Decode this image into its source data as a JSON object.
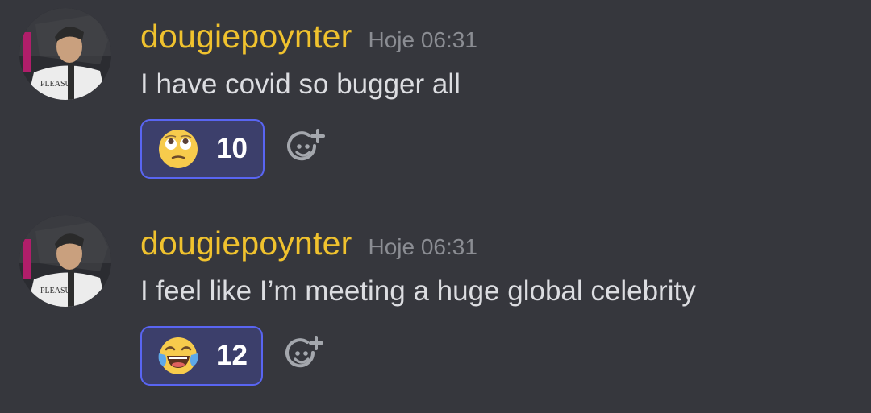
{
  "messages": [
    {
      "username": "dougiepoynter",
      "timestamp": "Hoje 06:31",
      "text": "I have covid so bugger all",
      "avatar_shirt_text": "PLEASU",
      "reaction": {
        "emoji": "face-with-rolling-eyes",
        "count": "10"
      }
    },
    {
      "username": "dougiepoynter",
      "timestamp": "Hoje 06:31",
      "text": "I feel like I’m meeting a huge global celebrity",
      "avatar_shirt_text": "PLEASU",
      "reaction": {
        "emoji": "face-with-tears-of-joy",
        "count": "12"
      }
    }
  ],
  "colors": {
    "background": "#36373d",
    "username": "#f0c22e",
    "timestamp": "#8b8d93",
    "message_text": "#dcdde1",
    "reaction_border": "#5965f2",
    "reaction_bg": "#3c3f6b"
  },
  "icons": {
    "add_reaction": "add-reaction-icon"
  }
}
